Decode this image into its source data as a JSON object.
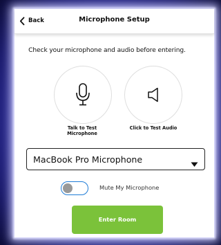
{
  "header": {
    "back_label": "Back",
    "title": "Microphone Setup"
  },
  "instruction": "Check your microphone and audio before entering.",
  "tests": {
    "mic_label": "Talk to Test Microphone",
    "audio_label": "Click to Test Audio"
  },
  "device_select": {
    "selected": "MacBook Pro Microphone"
  },
  "mute_toggle": {
    "label": "Mute My Microphone",
    "on": false
  },
  "enter_button": {
    "label": "Enter Room"
  },
  "colors": {
    "accent_green": "#7bc23a",
    "toggle_border": "#1e7bd6",
    "background": "#3a3ab8"
  },
  "icons": [
    "chevron-left-icon",
    "microphone-icon",
    "speaker-icon",
    "caret-down-icon"
  ]
}
